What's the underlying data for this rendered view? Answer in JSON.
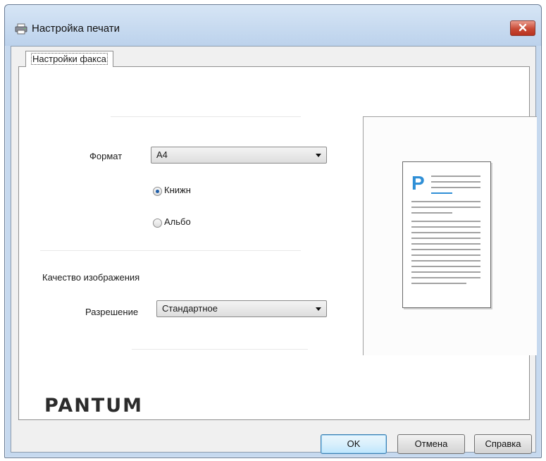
{
  "window": {
    "title": "Настройка печати",
    "icon": "printer-icon",
    "close_icon": "close-icon"
  },
  "tabs": [
    {
      "label": "Настройки факса",
      "selected": true
    }
  ],
  "settings": {
    "format_label": "Формат",
    "format_value": "A4",
    "orientation": {
      "portrait_label": "Книжн",
      "landscape_label": "Альбо",
      "selected": "portrait"
    },
    "quality_heading": "Качество изображения",
    "resolution_label": "Разрешение",
    "resolution_value": "Стандартное"
  },
  "preview": {
    "page_letter": "P",
    "accent_color": "#2f8fd6"
  },
  "brand": {
    "logo_text": "PANTUM"
  },
  "buttons": {
    "ok": "OK",
    "cancel": "Отмена",
    "help": "Справка"
  }
}
